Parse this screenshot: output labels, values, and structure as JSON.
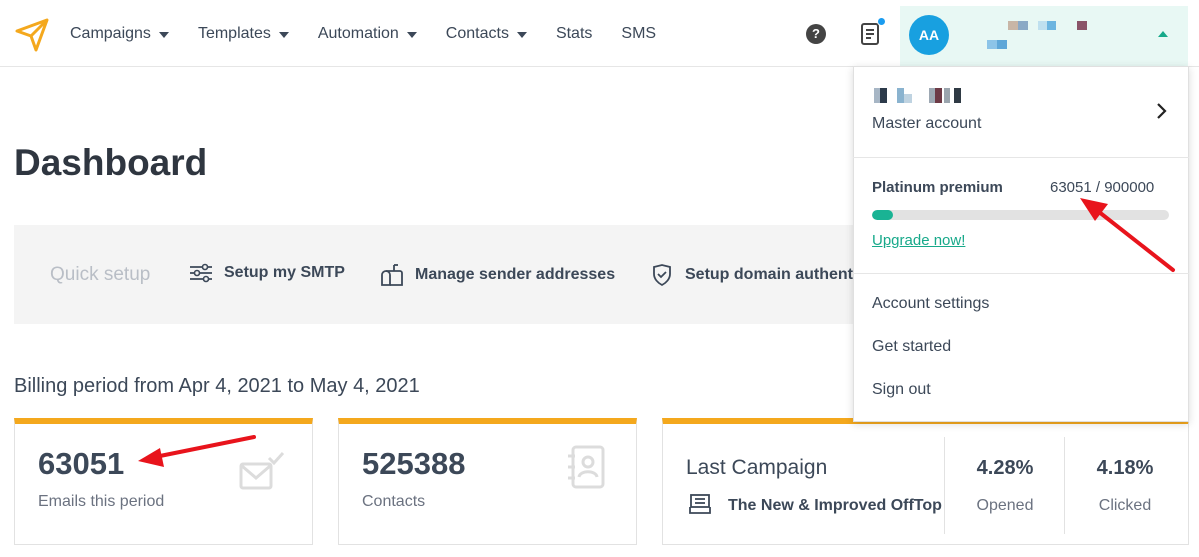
{
  "nav": {
    "items": [
      {
        "label": "Campaigns",
        "caret": true
      },
      {
        "label": "Templates",
        "caret": true
      },
      {
        "label": "Automation",
        "caret": true
      },
      {
        "label": "Contacts",
        "caret": true
      },
      {
        "label": "Stats",
        "caret": false
      },
      {
        "label": "SMS",
        "caret": false
      }
    ],
    "help_glyph": "?",
    "avatar_initials": "AA"
  },
  "main": {
    "title": "Dashboard",
    "quick_setup": {
      "label": "Quick setup",
      "items": [
        "Setup my SMTP",
        "Manage sender addresses",
        "Setup domain authenti"
      ]
    },
    "billing": "Billing period from Apr 4, 2021 to May 4, 2021",
    "cards": {
      "emails": {
        "value": "63051",
        "label": "Emails this period"
      },
      "contacts": {
        "value": "525388",
        "label": "Contacts"
      },
      "last_campaign": {
        "title": "Last Campaign",
        "name": "The New & Improved OffTop",
        "opened_pct": "4.28%",
        "opened_label": "Opened",
        "clicked_pct": "4.18%",
        "clicked_label": "Clicked"
      }
    }
  },
  "dropdown": {
    "account_type": "Master account",
    "plan": "Platinum premium",
    "usage": "63051 / 900000",
    "usage_fraction": 0.07,
    "upgrade": "Upgrade now!",
    "links": [
      "Account settings",
      "Get started",
      "Sign out"
    ]
  },
  "colors": {
    "accent": "#f4a81d",
    "brand_green": "#17a98a",
    "avatar_blue": "#18a0e0",
    "annotation_red": "#e8141c"
  }
}
